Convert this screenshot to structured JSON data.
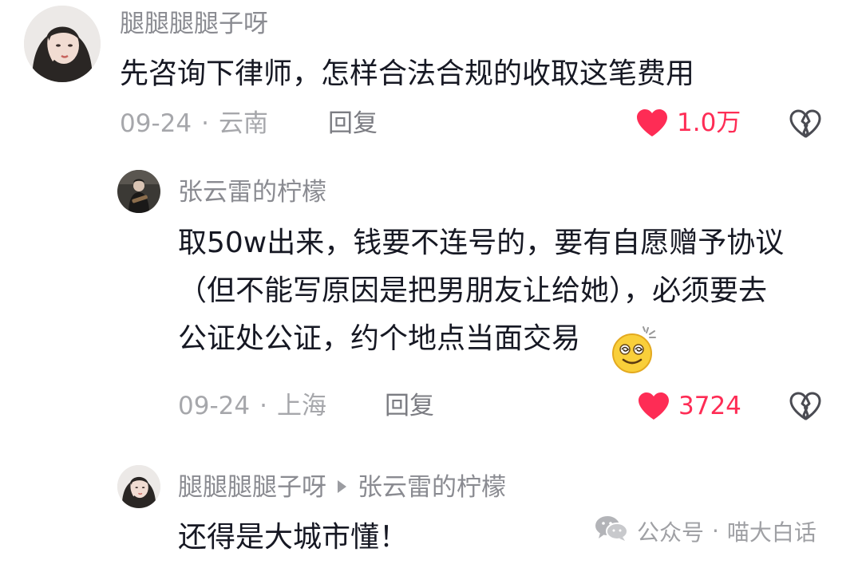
{
  "comments": [
    {
      "username": "腿腿腿腿子呀",
      "text_lines": [
        "先咨询下律师，怎样合法合规的收取这笔费用"
      ],
      "date": "09-24",
      "location": "云南",
      "reply_label": "回复",
      "likes": "1.0万"
    },
    {
      "username": "张云雷的柠檬",
      "text_lines": [
        "取50w出来，钱要不连号的，要有自愿赠予协议",
        "（但不能写原因是把男朋友让给她），必须要去",
        "公证处公证，约个地点当面交易"
      ],
      "date": "09-24",
      "location": "上海",
      "reply_label": "回复",
      "likes": "3724"
    },
    {
      "username": "腿腿腿腿子呀",
      "reply_to": "张云雷的柠檬",
      "text_lines": [
        "还得是大城市懂！"
      ]
    }
  ],
  "separator": "·",
  "watermark": {
    "prefix": "公众号",
    "sep": "·",
    "name": "喵大白话"
  },
  "colors": {
    "like_red": "#fe2c55",
    "meta_gray": "#a6a7ab",
    "username_gray": "#8a8b91",
    "text": "#161823"
  },
  "icons": {
    "like": "heart-icon",
    "dislike": "broken-heart-icon",
    "emoji": "dizzy-smile-emoji",
    "watermark": "wechat-icon"
  }
}
